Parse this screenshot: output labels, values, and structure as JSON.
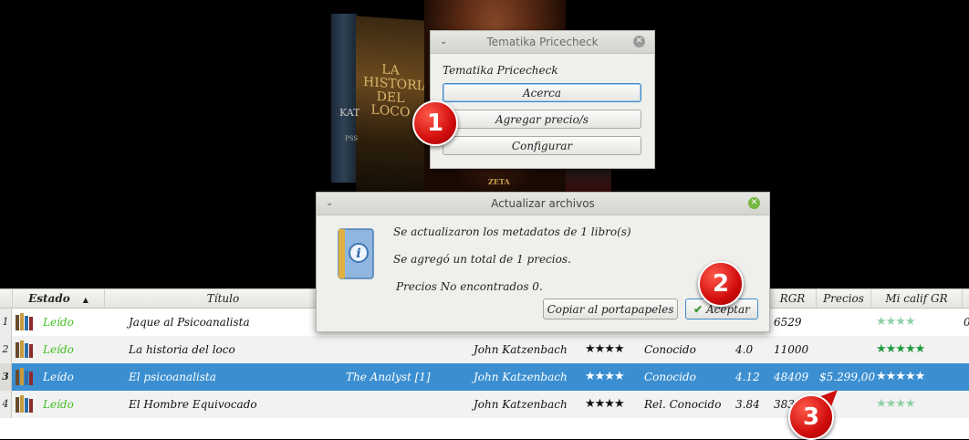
{
  "covers": {
    "cover2_title": "LA HISTORIA DEL LOCO",
    "cover3_publisher": "ZETA",
    "author_fragment": "KAT",
    "small_text": "PSS"
  },
  "pricecheck_dialog": {
    "title": "Tematika Pricecheck",
    "heading": "Tematika Pricecheck",
    "buttons": [
      "Acerca",
      "Agregar precio/s",
      "Configurar"
    ]
  },
  "update_dialog": {
    "title": "Actualizar archivos",
    "messages": [
      "Se actualizaron los metadatos de 1 libro(s)",
      "Se agregó un total de 1 precios.",
      "Precios  No encontrados 0."
    ],
    "copy_button": "Copiar al portapapeles",
    "accept_button": "Aceptar"
  },
  "table": {
    "headers": {
      "estado": "Estado",
      "titulo": "Título",
      "rgr": "RGR",
      "precios": "Precios",
      "mi_calif": "Mi calif GR"
    },
    "rows": [
      {
        "num": "1",
        "estado": "Leído",
        "titulo": "Jaque al Psicoanalista",
        "serie": "",
        "autor": "",
        "rating": "",
        "estado_gr": "",
        "valor": "",
        "rgr": "6529",
        "precio": "",
        "mi_calif": "★★★★",
        "extra": "0"
      },
      {
        "num": "2",
        "estado": "Leído",
        "titulo": "La historia del loco",
        "serie": "",
        "autor": "John Katzenbach",
        "rating": "★★★★",
        "estado_gr": "Conocido",
        "valor": "4.0",
        "rgr": "11000",
        "precio": "",
        "mi_calif": "★★★★★",
        "extra": ""
      },
      {
        "num": "3",
        "estado": "Leído",
        "titulo": "El psicoanalista",
        "serie": "The Analyst [1]",
        "autor": "John Katzenbach",
        "rating": "★★★★",
        "estado_gr": "Conocido",
        "valor": "4.12",
        "rgr": "48409",
        "precio": "$5.299,00",
        "mi_calif": "★★★★★",
        "extra": ""
      },
      {
        "num": "4",
        "estado": "Leído",
        "titulo": "El Hombre Equivocado",
        "serie": "",
        "autor": "John Katzenbach",
        "rating": "★★★★",
        "estado_gr": "Rel. Conocido",
        "valor": "3.84",
        "rgr": "3838",
        "precio": "",
        "mi_calif": "★★★★",
        "extra": ""
      }
    ]
  },
  "badges": [
    "1",
    "2",
    "3"
  ],
  "colors": {
    "selection": "#3b8fd1",
    "leido_green": "#3fbf1e",
    "badge_red": "#d10d0d"
  }
}
